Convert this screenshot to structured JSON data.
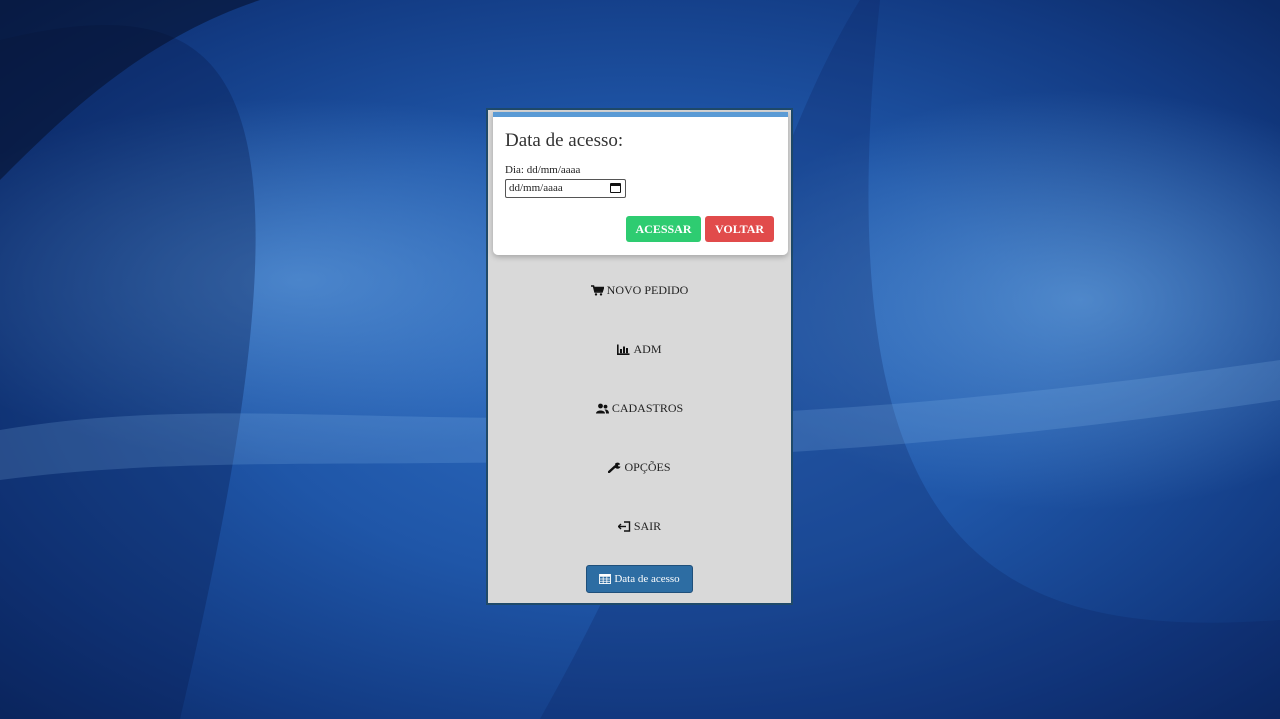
{
  "dialog": {
    "title": "Data de acesso:",
    "date_label": "Dia: dd/mm/aaaa",
    "date_value": "dd/mm/aaaa",
    "accent_color": "#5b9bd5",
    "buttons": {
      "acessar": "ACESSAR",
      "voltar": "VOLTAR",
      "acessar_color": "#2ecc71",
      "voltar_color": "#e14b4b"
    }
  },
  "menu": {
    "items": [
      {
        "label": "NOVO PEDIDO",
        "icon": "cart-icon"
      },
      {
        "label": "ADM",
        "icon": "bar-chart-icon"
      },
      {
        "label": "CADASTROS",
        "icon": "users-icon"
      },
      {
        "label": "OPÇÕES",
        "icon": "wrench-icon"
      },
      {
        "label": "SAIR",
        "icon": "sign-out-icon"
      }
    ]
  },
  "access_button": {
    "label": "Data de acesso",
    "icon": "table-icon",
    "color": "#2d6da3"
  }
}
